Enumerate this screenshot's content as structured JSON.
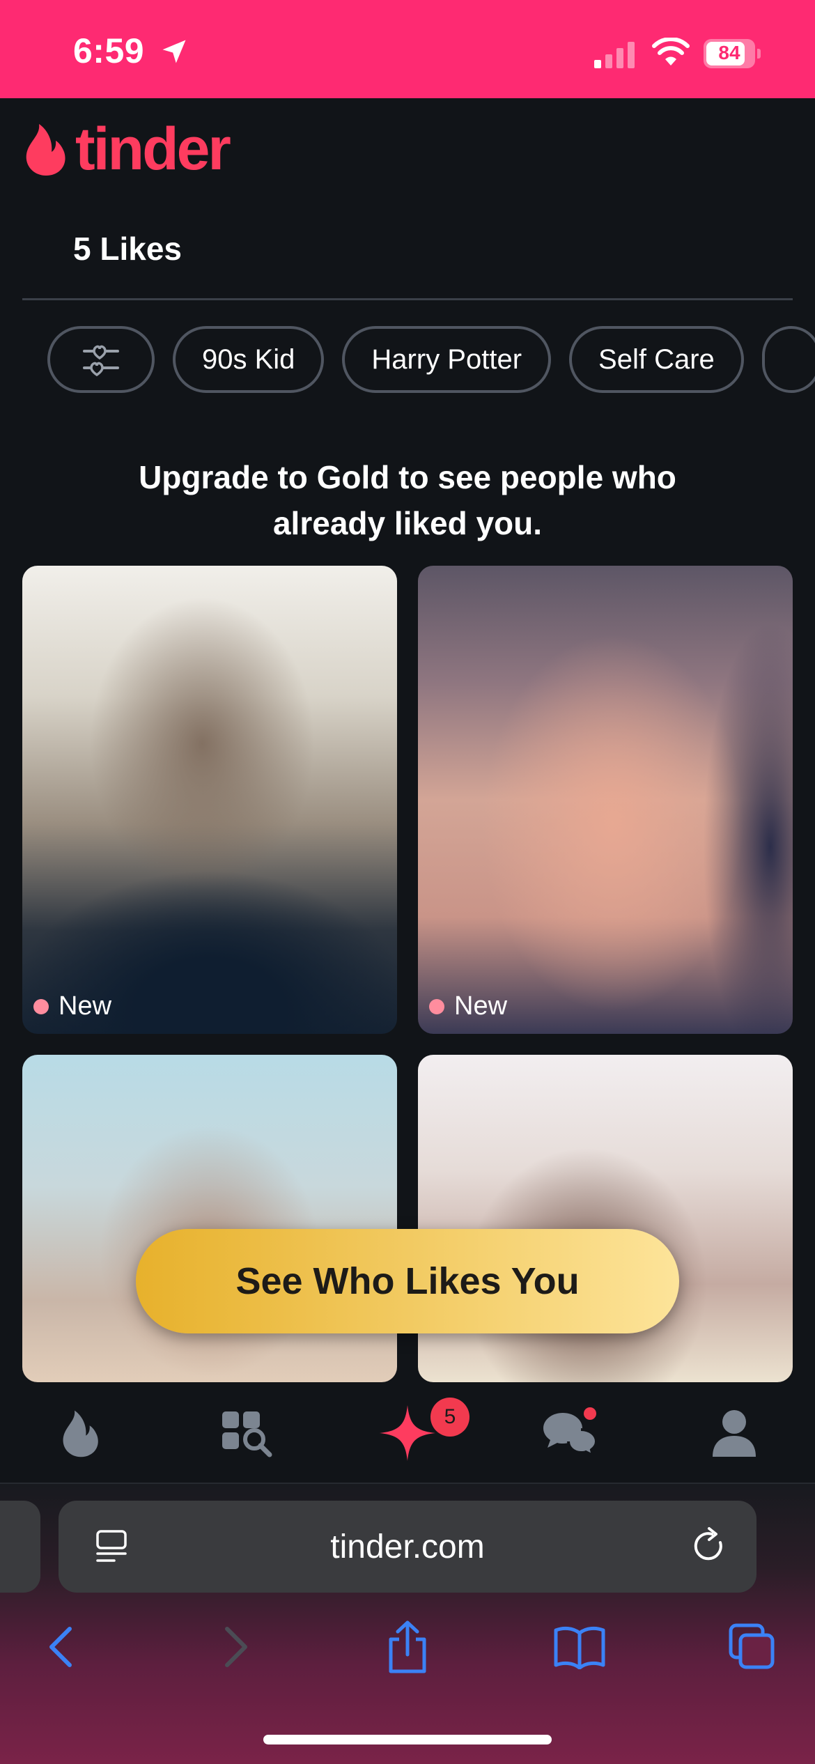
{
  "status_bar": {
    "time": "6:59",
    "battery_level": "84",
    "battery_fraction": 0.84,
    "signal_bars_active": 1,
    "background_color": "#fe2a72"
  },
  "header": {
    "logo_text": "tinder",
    "brand_color": "#fe3c5f"
  },
  "tabs": {
    "likes_label": "5 Likes"
  },
  "filters": {
    "items": [
      "90s Kid",
      "Harry Potter",
      "Self Care"
    ]
  },
  "upgrade": {
    "line1": "Upgrade to Gold to see people who",
    "line2": "already liked you."
  },
  "cards": [
    {
      "tag": "New"
    },
    {
      "tag": "New"
    },
    {
      "tag": ""
    },
    {
      "tag": ""
    }
  ],
  "cta": {
    "label": "See Who Likes You",
    "gradient_start": "#e7b12c",
    "gradient_end": "#fde49a"
  },
  "bottom_nav": {
    "items": [
      "flame-icon",
      "explore-icon",
      "likes-sparkle-icon",
      "chat-icon",
      "profile-icon"
    ],
    "likes_badge": "5",
    "active_color": "#fe3c5f",
    "inactive_color": "#7c8591"
  },
  "browser": {
    "url": "tinder.com",
    "toolbar": [
      "back-icon",
      "forward-icon",
      "share-icon",
      "bookmarks-icon",
      "tabs-icon"
    ],
    "accent_color": "#3b82f6"
  }
}
